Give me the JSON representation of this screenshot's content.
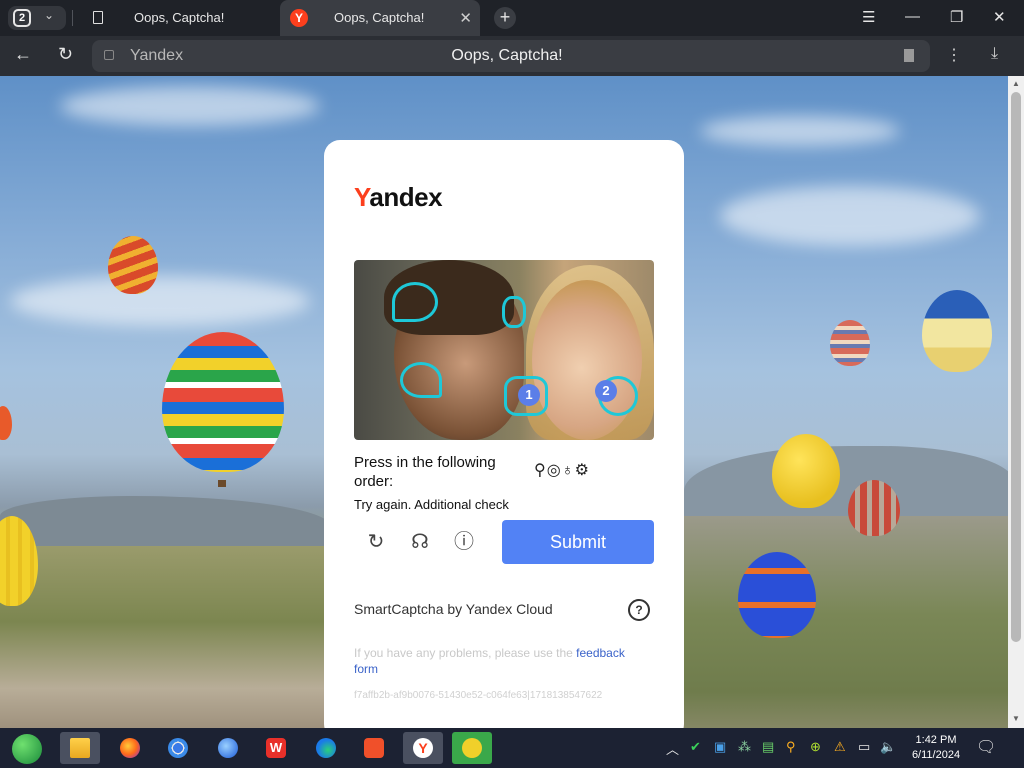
{
  "browser": {
    "tab_count": "2",
    "tabs": [
      {
        "title": "Oops, Captcha!",
        "icon": "document-icon"
      },
      {
        "title": "Oops, Captcha!",
        "icon": "yandex-icon",
        "active": true
      }
    ],
    "address": {
      "host": "Yandex",
      "page_title": "Oops, Captcha!"
    }
  },
  "captcha": {
    "logo": {
      "first": "Y",
      "rest": "andex"
    },
    "instruction": "Press in the following order:",
    "task_symbols": "⚲◎♁⚙",
    "marks": [
      "1",
      "2"
    ],
    "retry_message": "Try again. Additional check",
    "submit_label": "Submit",
    "brand": "SmartCaptcha by Yandex Cloud",
    "help_label": "?",
    "problems_text": "If you have any problems, please use the",
    "feedback_link": "feedback form",
    "request_id": "f7affb2b-af9b0076-51430e52-c064fe63|1718138547622"
  },
  "taskbar": {
    "time": "1:42 PM",
    "date": "6/11/2024"
  },
  "colors": {
    "accent": "#5282f5",
    "yandex_red": "#fc3f1d",
    "mark": "#1ec8d8"
  }
}
